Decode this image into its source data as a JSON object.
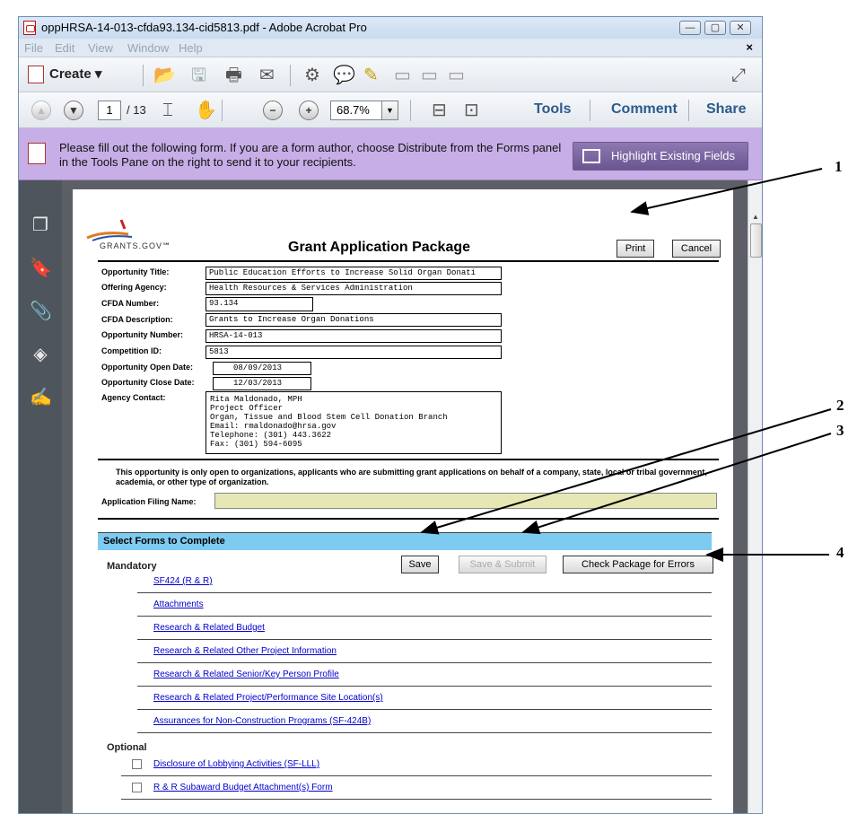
{
  "window": {
    "title": "oppHRSA-14-013-cfda93.134-cid5813.pdf - Adobe Acrobat Pro",
    "minimize_label": "—",
    "maximize_label": "▢",
    "close_label": "✕"
  },
  "menu": {
    "items": [
      "File",
      "Edit",
      "View",
      "Window",
      "Help"
    ],
    "close_label": "×"
  },
  "toolbar": {
    "create_label": "Create ▾",
    "page_current": "1",
    "page_total": "/ 13",
    "zoom_value": "68.7%",
    "zoom_dropdown": "▼",
    "tools_label": "Tools",
    "comment_label": "Comment",
    "share_label": "Share"
  },
  "banner": {
    "message": "Please fill out the following form. If you are a form author, choose Distribute from the Forms panel in the Tools Pane on the right to send it to your recipients.",
    "highlight_button_label": "Highlight Existing Fields"
  },
  "form": {
    "logo_text": "GRANTS.GOV℠",
    "title": "Grant Application Package",
    "print_label": "Print",
    "cancel_label": "Cancel",
    "fields": {
      "opportunity_title_label": "Opportunity Title:",
      "opportunity_title_value": "Public Education Efforts to Increase Solid Organ Donati",
      "offering_agency_label": "Offering Agency:",
      "offering_agency_value": "Health Resources & Services Administration",
      "cfda_number_label": "CFDA Number:",
      "cfda_number_value": "93.134",
      "cfda_description_label": "CFDA Description:",
      "cfda_description_value": "Grants to Increase Organ Donations",
      "opportunity_number_label": "Opportunity Number:",
      "opportunity_number_value": "HRSA-14-013",
      "competition_id_label": "Competition ID:",
      "competition_id_value": "5813",
      "open_date_label": "Opportunity Open Date:",
      "open_date_value": "08/09/2013",
      "close_date_label": "Opportunity Close Date:",
      "close_date_value": "12/03/2013",
      "agency_contact_label": "Agency Contact:",
      "agency_contact_value": "Rita Maldonado, MPH\nProject Officer\nOrgan, Tissue and Blood Stem Cell Donation Branch\nEmail: rmaldonado@hrsa.gov\nTelephone: (301) 443.3622\nFax: (301) 594-6095"
    },
    "notice": "This opportunity is only open to organizations, applicants who are submitting grant applications on behalf of a company, state, local or tribal government, academia, or other type of organization.",
    "filing_name_label": "Application Filing Name:",
    "select_forms_label": "Select Forms to Complete",
    "mandatory_label": "Mandatory",
    "save_label": "Save",
    "save_submit_label": "Save & Submit",
    "check_errors_label": "Check Package for Errors",
    "mandatory_forms": [
      "SF424 (R & R)",
      "Attachments",
      "Research & Related Budget",
      "Research & Related Other Project Information",
      "Research & Related Senior/Key Person Profile",
      "Research & Related Project/Performance Site Location(s)",
      "Assurances for Non-Construction Programs (SF-424B)"
    ],
    "optional_label": "Optional",
    "optional_forms": [
      "Disclosure of Lobbying Activities (SF-LLL)",
      "R & R Subaward Budget Attachment(s) Form"
    ]
  },
  "callouts": [
    "1",
    "2",
    "3",
    "4"
  ]
}
